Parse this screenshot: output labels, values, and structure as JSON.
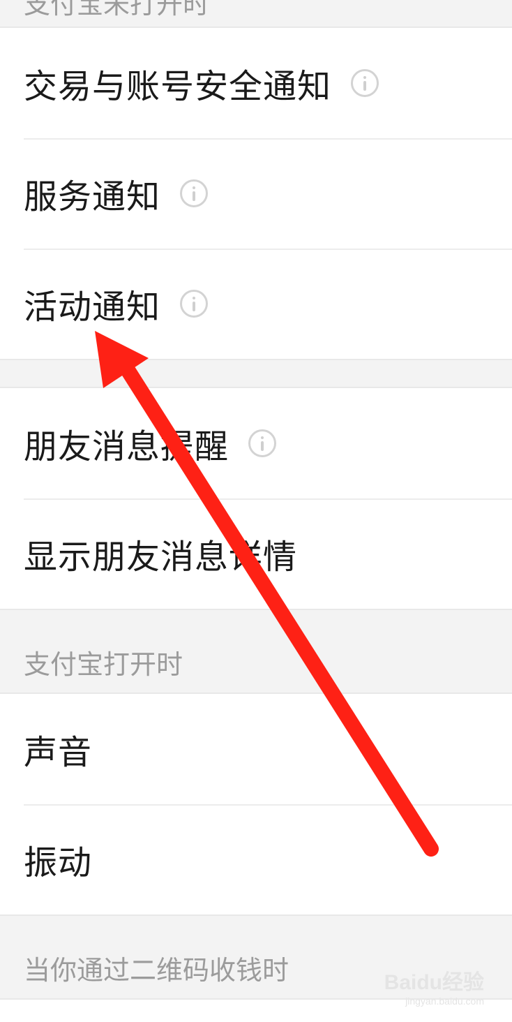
{
  "sections": {
    "top_header_label": "支付宝未打开时",
    "opened_header_label": "支付宝打开时",
    "qr_header_label": "当你通过二维码收钱时"
  },
  "group1": {
    "items": [
      {
        "label": "交易与账号安全通知",
        "has_info": true
      },
      {
        "label": "服务通知",
        "has_info": true
      },
      {
        "label": "活动通知",
        "has_info": true
      }
    ]
  },
  "group2": {
    "items": [
      {
        "label": "朋友消息提醒",
        "has_info": true
      },
      {
        "label": "显示朋友消息详情",
        "has_info": false
      }
    ]
  },
  "group3": {
    "items": [
      {
        "label": "声音"
      },
      {
        "label": "振动"
      }
    ]
  },
  "icons": {
    "info": "info-circle-icon"
  },
  "annotation": {
    "arrow_color": "#fe2115"
  },
  "watermark": {
    "brand": "Baidu经验",
    "url": "jingyan.baidu.com"
  }
}
